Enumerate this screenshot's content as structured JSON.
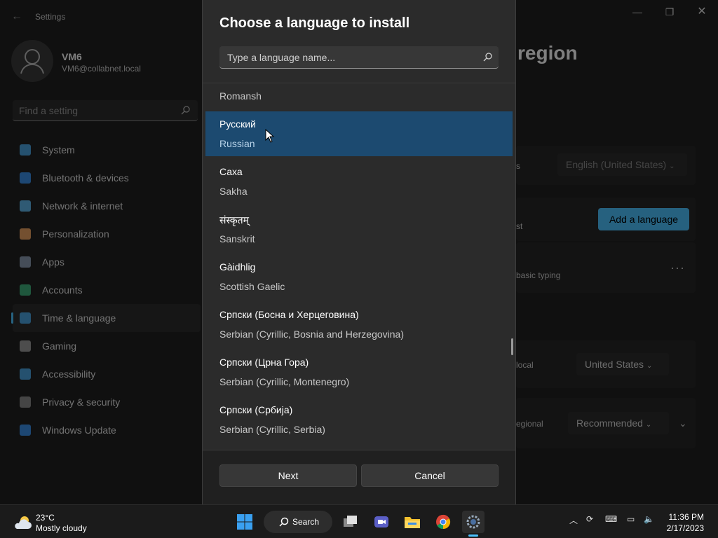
{
  "settings": {
    "app_title": "Settings",
    "user": {
      "name": "VM6",
      "email": "VM6@collabnet.local"
    },
    "search_placeholder": "Find a setting",
    "nav": [
      {
        "label": "System",
        "icon": "monitor-icon",
        "color": "#4aa3df"
      },
      {
        "label": "Bluetooth & devices",
        "icon": "bluetooth-icon",
        "color": "#3a8ee6"
      },
      {
        "label": "Network & internet",
        "icon": "wifi-icon",
        "color": "#5fb4e8"
      },
      {
        "label": "Personalization",
        "icon": "brush-icon",
        "color": "#e8a060"
      },
      {
        "label": "Apps",
        "icon": "apps-icon",
        "color": "#8a9bb0"
      },
      {
        "label": "Accounts",
        "icon": "person-icon",
        "color": "#3fae7a"
      },
      {
        "label": "Time & language",
        "icon": "globe-clock-icon",
        "color": "#4aa3df"
      },
      {
        "label": "Gaming",
        "icon": "gamepad-icon",
        "color": "#9a9a9a"
      },
      {
        "label": "Accessibility",
        "icon": "accessibility-icon",
        "color": "#4aa3df"
      },
      {
        "label": "Privacy & security",
        "icon": "shield-icon",
        "color": "#8a8a8a"
      },
      {
        "label": "Windows Update",
        "icon": "update-icon",
        "color": "#3a8ee6"
      }
    ],
    "selected_nav": "Time & language",
    "page_title_fragment": "region",
    "bg": {
      "display_lang_fragment": "s",
      "display_lang_value": "English (United States)",
      "add_language": "Add a language",
      "pref_fragment": "st",
      "basic_typing": "basic typing",
      "region_fragment": "local",
      "region_value": "United States",
      "format_fragment": "egional",
      "format_value": "Recommended"
    }
  },
  "dialog": {
    "title": "Choose a language to install",
    "search_placeholder": "Type a language name...",
    "languages": [
      {
        "native": "",
        "english": "Romansh"
      },
      {
        "native": "Русский",
        "english": "Russian",
        "selected": true
      },
      {
        "native": "Саха",
        "english": "Sakha"
      },
      {
        "native": "संस्कृतम्",
        "english": "Sanskrit"
      },
      {
        "native": "Gàidhlig",
        "english": "Scottish Gaelic"
      },
      {
        "native": "Српски (Босна и Херцеговина)",
        "english": "Serbian (Cyrillic, Bosnia and Herzegovina)"
      },
      {
        "native": "Српски (Црна Гора)",
        "english": "Serbian (Cyrillic, Montenegro)"
      },
      {
        "native": "Српски (Србија)",
        "english": "Serbian (Cyrillic, Serbia)"
      }
    ],
    "next_label": "Next",
    "cancel_label": "Cancel"
  },
  "taskbar": {
    "weather_temp": "23°C",
    "weather_desc": "Mostly cloudy",
    "search_label": "Search",
    "time": "11:36 PM",
    "date": "2/17/2023"
  }
}
